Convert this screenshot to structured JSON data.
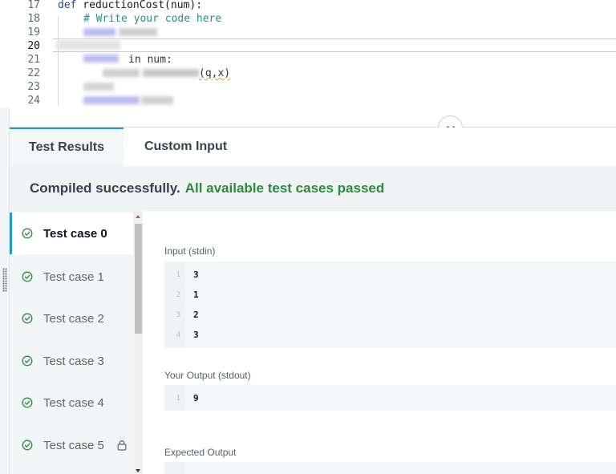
{
  "editor": {
    "lines": [
      {
        "num": "17",
        "kw": "def",
        "text": " reductionCost(num):"
      },
      {
        "num": "18",
        "comment": "# Write your code here"
      },
      {
        "num": "19"
      },
      {
        "num": "20"
      },
      {
        "num": "21",
        "visible_text": "in num:"
      },
      {
        "num": "22",
        "visible_text": "(q,x)"
      },
      {
        "num": "23"
      },
      {
        "num": "24"
      }
    ]
  },
  "tabs": {
    "test_results": "Test Results",
    "custom_input": "Custom Input"
  },
  "banner": {
    "compiled": "Compiled successfully.",
    "passed": "All available test cases passed"
  },
  "test_cases": [
    {
      "label": "Test case 0",
      "active": true
    },
    {
      "label": "Test case 1"
    },
    {
      "label": "Test case 2"
    },
    {
      "label": "Test case 3"
    },
    {
      "label": "Test case 4"
    },
    {
      "label": "Test case 5",
      "locked": true
    }
  ],
  "output": {
    "input_label": "Input (stdin)",
    "input_lines": [
      {
        "n": "1",
        "v": "3"
      },
      {
        "n": "2",
        "v": "1"
      },
      {
        "n": "3",
        "v": "2"
      },
      {
        "n": "4",
        "v": "3"
      }
    ],
    "your_output_label": "Your Output (stdout)",
    "your_output_lines": [
      {
        "n": "1",
        "v": "9"
      }
    ],
    "expected_label": "Expected Output"
  },
  "colors": {
    "accent": "#1f9bcf",
    "success": "#2e8b3e",
    "keyword": "#1e4ba0",
    "comment": "#2e8b8b"
  },
  "icons": {
    "collapse": "chevron-down-icon",
    "case_status": "check-circle-icon",
    "locked": "lock-icon"
  }
}
